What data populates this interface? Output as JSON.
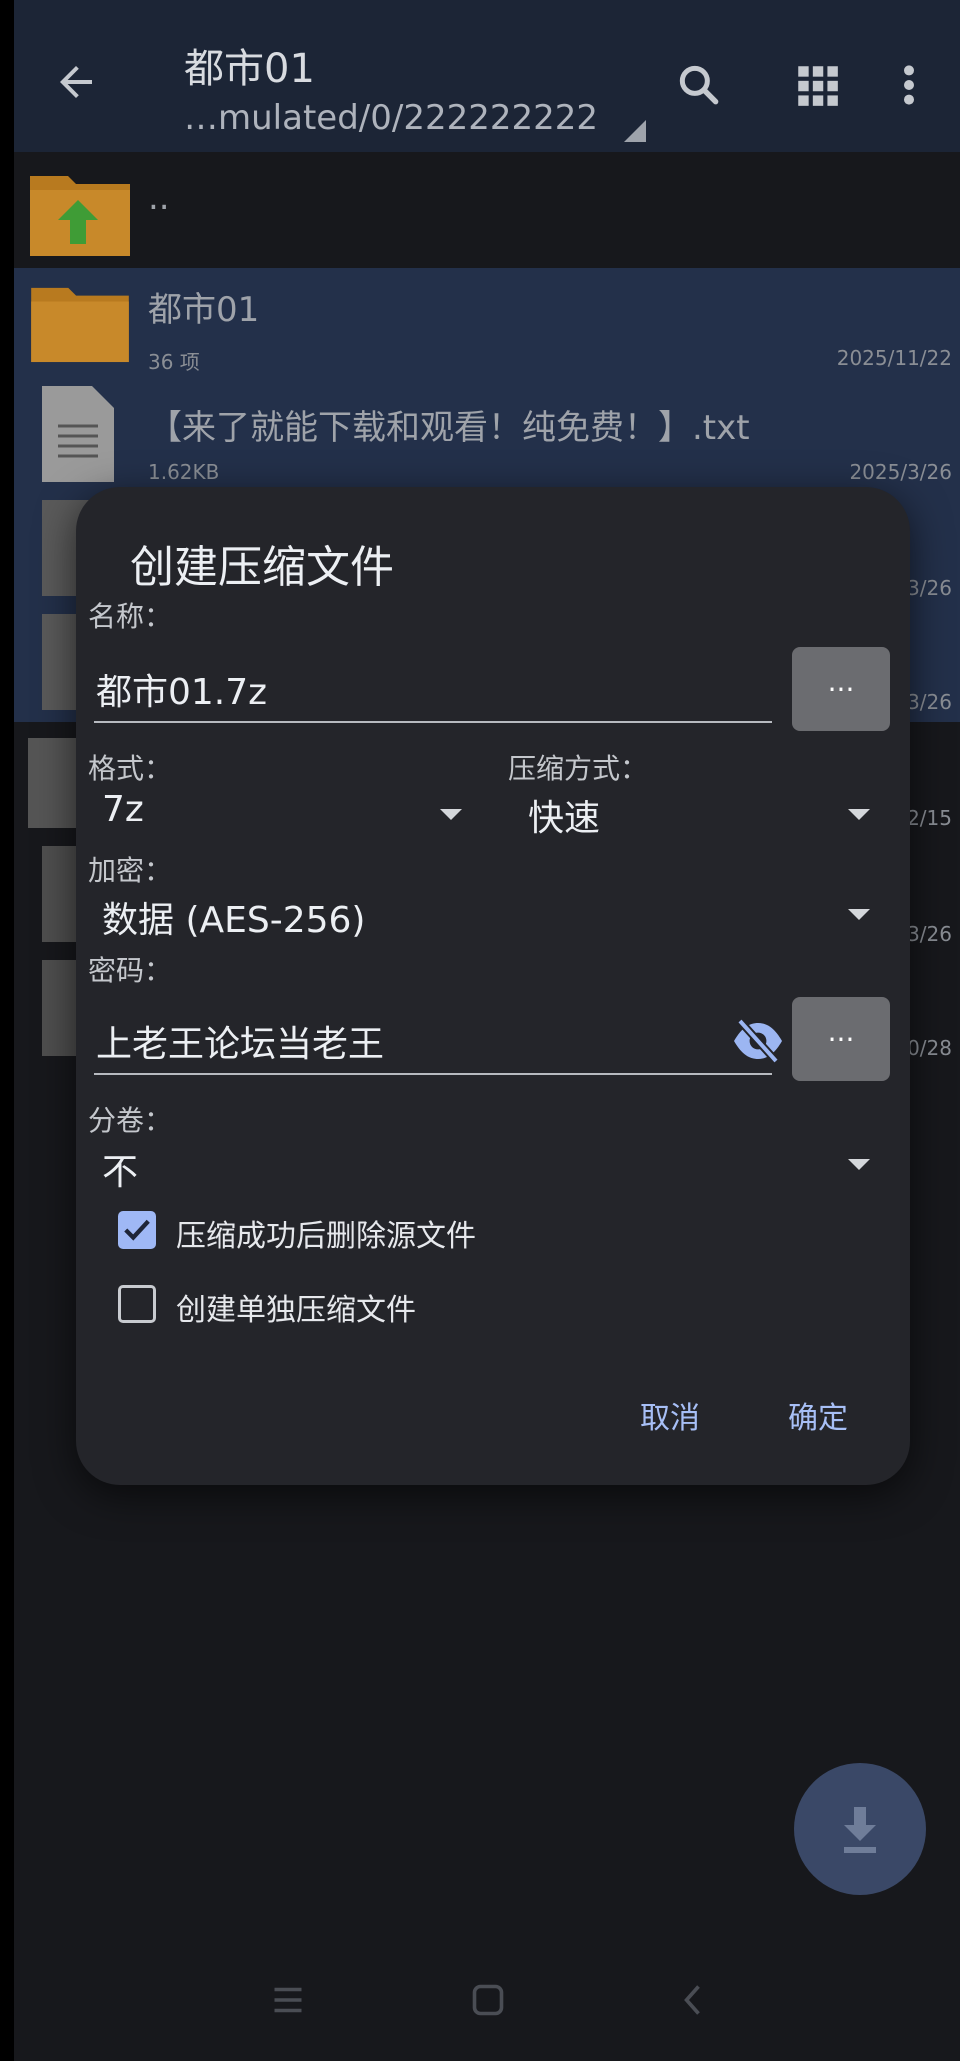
{
  "appbar": {
    "title": "都市01",
    "path": "…mulated/0/222222222",
    "back_icon": "arrow-back-icon",
    "search_icon": "search-icon",
    "grid_icon": "grid-view-icon",
    "more_icon": "more-vert-icon"
  },
  "list": {
    "parent": {
      "name": ".."
    },
    "items": [
      {
        "name": "都市01",
        "meta": "36 项",
        "date": "2025/11/22",
        "type": "folder"
      },
      {
        "name": "【来了就能下载和观看！纯免费！】.txt",
        "meta": "1.62KB",
        "date": "2025/3/26",
        "type": "doc"
      }
    ],
    "partial_dates": [
      "3/26",
      "3/26",
      "2/15",
      "3/26",
      "0/28"
    ]
  },
  "dialog": {
    "title": "创建压缩文件",
    "name_label": "名称：",
    "name_value": "都市01.7z",
    "browse_label": "...",
    "format_label": "格式：",
    "format_value": "7z",
    "method_label": "压缩方式：",
    "method_value": "快速",
    "encrypt_label": "加密：",
    "encrypt_value": "数据 (AES-256)",
    "password_label": "密码：",
    "password_value": "上老王论坛当老王",
    "password_btn_label": "...",
    "split_label": "分卷：",
    "split_value": "不",
    "delete_source_label": "压缩成功后删除源文件",
    "delete_source_checked": true,
    "separate_label": "创建单独压缩文件",
    "separate_checked": false,
    "cancel_label": "取消",
    "ok_label": "确定"
  },
  "colors": {
    "accent": "#a7bff6",
    "dialog_bg": "#24252a",
    "appbar_bg": "#1c2536",
    "selection_bg": "#23304a"
  }
}
